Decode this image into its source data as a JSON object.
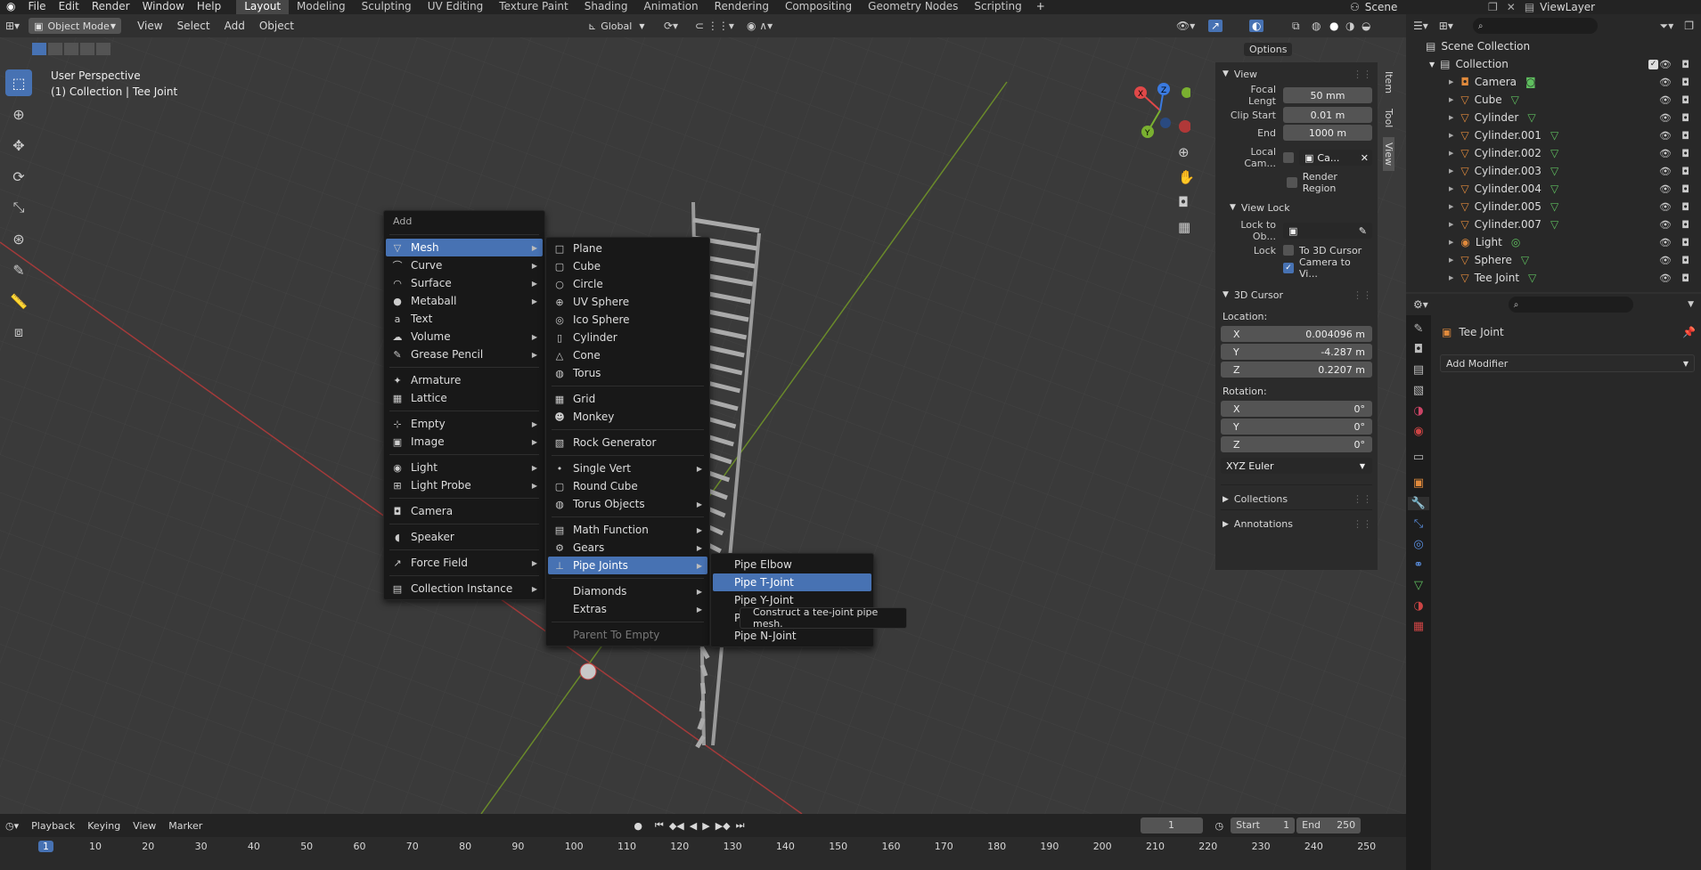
{
  "topmenu": {
    "file": "File",
    "edit": "Edit",
    "render": "Render",
    "window": "Window",
    "help": "Help"
  },
  "workspaces": [
    "Layout",
    "Modeling",
    "Sculpting",
    "UV Editing",
    "Texture Paint",
    "Shading",
    "Animation",
    "Rendering",
    "Compositing",
    "Geometry Nodes",
    "Scripting"
  ],
  "scene": "Scene",
  "viewlayer": "ViewLayer",
  "header": {
    "mode": "Object Mode",
    "view": "View",
    "select": "Select",
    "add": "Add",
    "object": "Object",
    "transform": "Global",
    "options": "Options"
  },
  "viewport": {
    "title": "User Perspective",
    "subtitle": "(1) Collection | Tee Joint"
  },
  "add_menu": {
    "title": "Add",
    "items": [
      {
        "label": "Mesh",
        "icon": "▽",
        "sub": true,
        "hl": true
      },
      {
        "label": "Curve",
        "icon": "⌒",
        "sub": true
      },
      {
        "label": "Surface",
        "icon": "◠",
        "sub": true
      },
      {
        "label": "Metaball",
        "icon": "●",
        "sub": true
      },
      {
        "label": "Text",
        "icon": "a",
        "sub": false
      },
      {
        "label": "Volume",
        "icon": "☁",
        "sub": true
      },
      {
        "label": "Grease Pencil",
        "icon": "✎",
        "sub": true
      },
      {
        "sep": true
      },
      {
        "label": "Armature",
        "icon": "✦",
        "sub": false
      },
      {
        "label": "Lattice",
        "icon": "▦",
        "sub": false
      },
      {
        "sep": true
      },
      {
        "label": "Empty",
        "icon": "⊹",
        "sub": true
      },
      {
        "label": "Image",
        "icon": "▣",
        "sub": true
      },
      {
        "sep": true
      },
      {
        "label": "Light",
        "icon": "◉",
        "sub": true
      },
      {
        "label": "Light Probe",
        "icon": "⊞",
        "sub": true
      },
      {
        "sep": true
      },
      {
        "label": "Camera",
        "icon": "◘",
        "sub": false
      },
      {
        "sep": true
      },
      {
        "label": "Speaker",
        "icon": "◖",
        "sub": false
      },
      {
        "sep": true
      },
      {
        "label": "Force Field",
        "icon": "↗",
        "sub": true
      },
      {
        "sep": true
      },
      {
        "label": "Collection Instance",
        "icon": "▤",
        "sub": true
      }
    ]
  },
  "mesh_menu": {
    "items": [
      {
        "label": "Plane",
        "icon": "□"
      },
      {
        "label": "Cube",
        "icon": "▢"
      },
      {
        "label": "Circle",
        "icon": "○"
      },
      {
        "label": "UV Sphere",
        "icon": "⊕"
      },
      {
        "label": "Ico Sphere",
        "icon": "◎"
      },
      {
        "label": "Cylinder",
        "icon": "▯"
      },
      {
        "label": "Cone",
        "icon": "△"
      },
      {
        "label": "Torus",
        "icon": "◍"
      },
      {
        "sep": true
      },
      {
        "label": "Grid",
        "icon": "▦"
      },
      {
        "label": "Monkey",
        "icon": "☻"
      },
      {
        "sep": true
      },
      {
        "label": "Rock Generator",
        "icon": "▧"
      },
      {
        "sep": true
      },
      {
        "label": "Single Vert",
        "icon": "•",
        "sub": true
      },
      {
        "label": "Round Cube",
        "icon": "▢"
      },
      {
        "label": "Torus Objects",
        "icon": "◍",
        "sub": true
      },
      {
        "sep": true
      },
      {
        "label": "Math Function",
        "icon": "▤",
        "sub": true
      },
      {
        "label": "Gears",
        "icon": "⚙",
        "sub": true
      },
      {
        "label": "Pipe Joints",
        "icon": "⊥",
        "sub": true,
        "hl": true
      },
      {
        "sep": true
      },
      {
        "label": "Diamonds",
        "icon": "",
        "sub": true
      },
      {
        "label": "Extras",
        "icon": "",
        "sub": true
      },
      {
        "sep": true
      },
      {
        "label": "Parent To Empty",
        "icon": "",
        "disabled": true
      }
    ]
  },
  "pipe_menu": {
    "items": [
      {
        "label": "Pipe Elbow"
      },
      {
        "label": "Pipe T-Joint",
        "hl": true
      },
      {
        "label": "Pipe Y-Joint"
      },
      {
        "label": "Pipe Cross-Joint"
      },
      {
        "label": "Pipe N-Joint"
      }
    ]
  },
  "tooltip": "Construct a tee-joint pipe mesh.",
  "npanel": {
    "view_header": "View",
    "focal_label": "Focal Lengt",
    "focal": "50 mm",
    "clip_start_label": "Clip Start",
    "clip_start": "0.01 m",
    "end_label": "End",
    "end": "1000 m",
    "local_cam_label": "Local Cam...",
    "local_cam": "Ca...",
    "render_region": "Render Region",
    "view_lock": "View Lock",
    "lock_to_obj": "Lock to Ob...",
    "lock_label": "Lock",
    "to_3d_cursor": "To 3D Cursor",
    "camera_to_view": "Camera to Vi...",
    "cursor_header": "3D Cursor",
    "location": "Location:",
    "x_label": "X",
    "x": "0.004096 m",
    "y_label": "Y",
    "y": "-4.287 m",
    "z_label": "Z",
    "z": "0.2207 m",
    "rotation": "Rotation:",
    "rx": "0°",
    "ry": "0°",
    "rz": "0°",
    "rot_mode": "XYZ Euler",
    "collections": "Collections",
    "annotations": "Annotations",
    "tabs": [
      "Item",
      "Tool",
      "View"
    ]
  },
  "outliner": {
    "scene_collection": "Scene Collection",
    "collection": "Collection",
    "objects": [
      {
        "name": "Camera",
        "type": "camera"
      },
      {
        "name": "Cube",
        "type": "mesh"
      },
      {
        "name": "Cylinder",
        "type": "mesh"
      },
      {
        "name": "Cylinder.001",
        "type": "mesh"
      },
      {
        "name": "Cylinder.002",
        "type": "mesh"
      },
      {
        "name": "Cylinder.003",
        "type": "mesh"
      },
      {
        "name": "Cylinder.004",
        "type": "mesh"
      },
      {
        "name": "Cylinder.005",
        "type": "mesh"
      },
      {
        "name": "Cylinder.007",
        "type": "mesh"
      },
      {
        "name": "Light",
        "type": "light"
      },
      {
        "name": "Sphere",
        "type": "mesh"
      },
      {
        "name": "Tee Joint",
        "type": "mesh"
      }
    ]
  },
  "properties": {
    "object_name": "Tee Joint",
    "add_modifier": "Add Modifier"
  },
  "timeline": {
    "playback": "Playback",
    "keying": "Keying",
    "view": "View",
    "marker": "Marker",
    "frame": "1",
    "start_label": "Start",
    "start": "1",
    "end_label": "End",
    "end": "250",
    "ticks": [
      "1",
      "10",
      "20",
      "30",
      "40",
      "50",
      "60",
      "70",
      "80",
      "90",
      "100",
      "110",
      "120",
      "130",
      "140",
      "150",
      "160",
      "170",
      "180",
      "190",
      "200",
      "210",
      "220",
      "230",
      "240",
      "250"
    ]
  }
}
